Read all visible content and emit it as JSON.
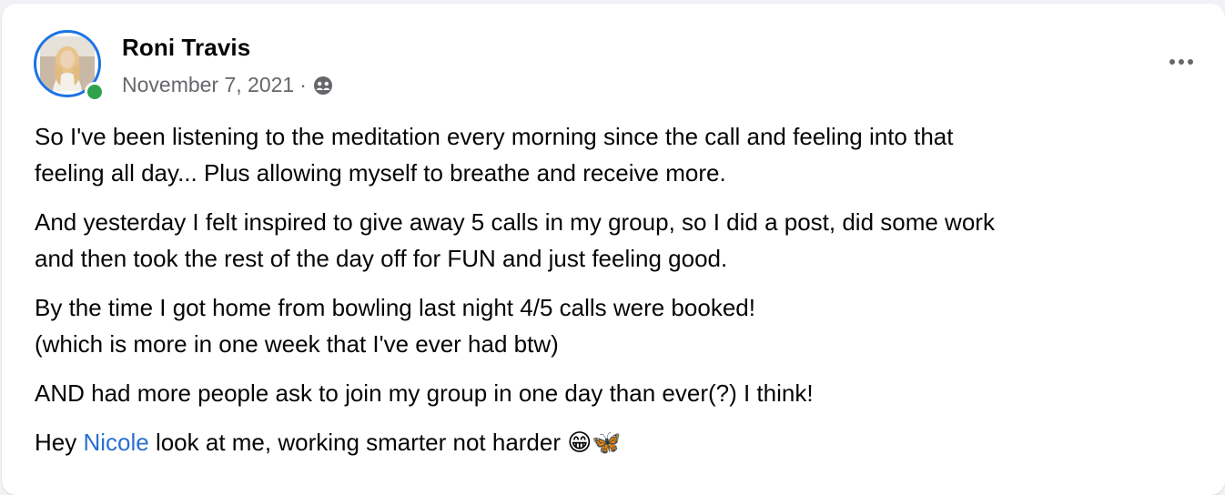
{
  "post": {
    "author": "Roni Travis",
    "date": "November 7, 2021",
    "separator": "·",
    "privacy_icon": "group-members-icon",
    "more_icon": "more-horizontal-icon",
    "online_color": "#31a24c",
    "ring_color": "#1b74e4",
    "paragraphs": [
      {
        "lines": [
          "So I've been listening to the meditation every morning since the call and feeling into that",
          "feeling all day... Plus allowing myself to breathe and receive more."
        ]
      },
      {
        "lines": [
          "And yesterday I felt inspired to give away 5 calls in my group, so I did a post, did some work",
          "and then took the rest of the day off for FUN and just feeling good."
        ]
      },
      {
        "lines": [
          "By the time I got home from bowling last night 4/5 calls were booked!",
          "(which is more in one week that I've ever had btw)"
        ]
      },
      {
        "lines": [
          "AND had more people ask to join my group in one day than ever(?) I think!"
        ]
      }
    ],
    "last": {
      "prefix": "Hey ",
      "mention": "Nicole",
      "suffix": " look at me, working smarter not harder ",
      "emojis": "😁🦋"
    }
  }
}
